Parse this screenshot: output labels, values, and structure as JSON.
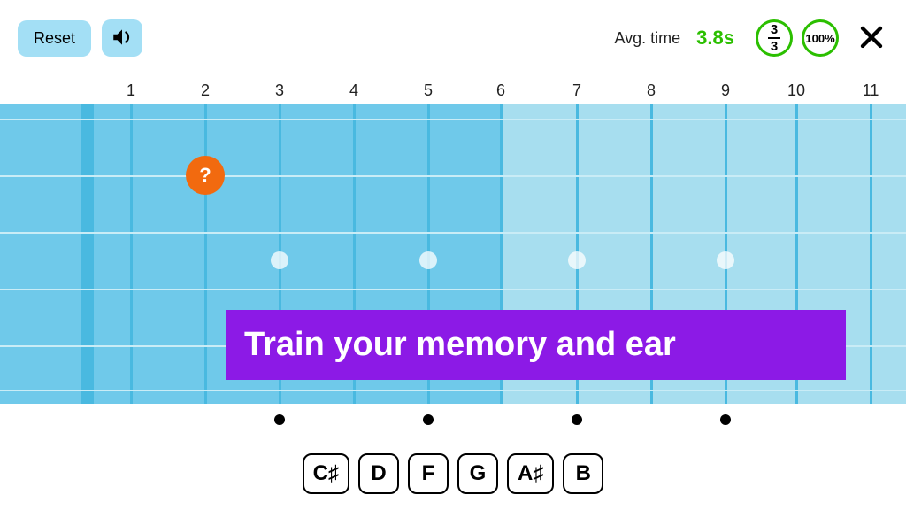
{
  "toolbar": {
    "reset_label": "Reset",
    "avg_label": "Avg. time",
    "avg_value": "3.8s",
    "score_num": "3",
    "score_den": "3",
    "percent": "100%"
  },
  "fretboard": {
    "fret_labels": [
      "1",
      "2",
      "3",
      "4",
      "5",
      "6",
      "7",
      "8",
      "9",
      "10",
      "11"
    ],
    "fret_x": [
      148,
      232,
      316,
      400,
      484,
      566,
      652,
      736,
      820,
      900,
      984
    ],
    "string_y": [
      16,
      80,
      144,
      208,
      272,
      322
    ],
    "inlay_frets": [
      3,
      5,
      7,
      9
    ],
    "question": {
      "fret": 2,
      "string_index": 1,
      "label": "?"
    }
  },
  "banner": {
    "text": "Train your memory and ear"
  },
  "notes": [
    "C♯",
    "D",
    "F",
    "G",
    "A♯",
    "B"
  ]
}
